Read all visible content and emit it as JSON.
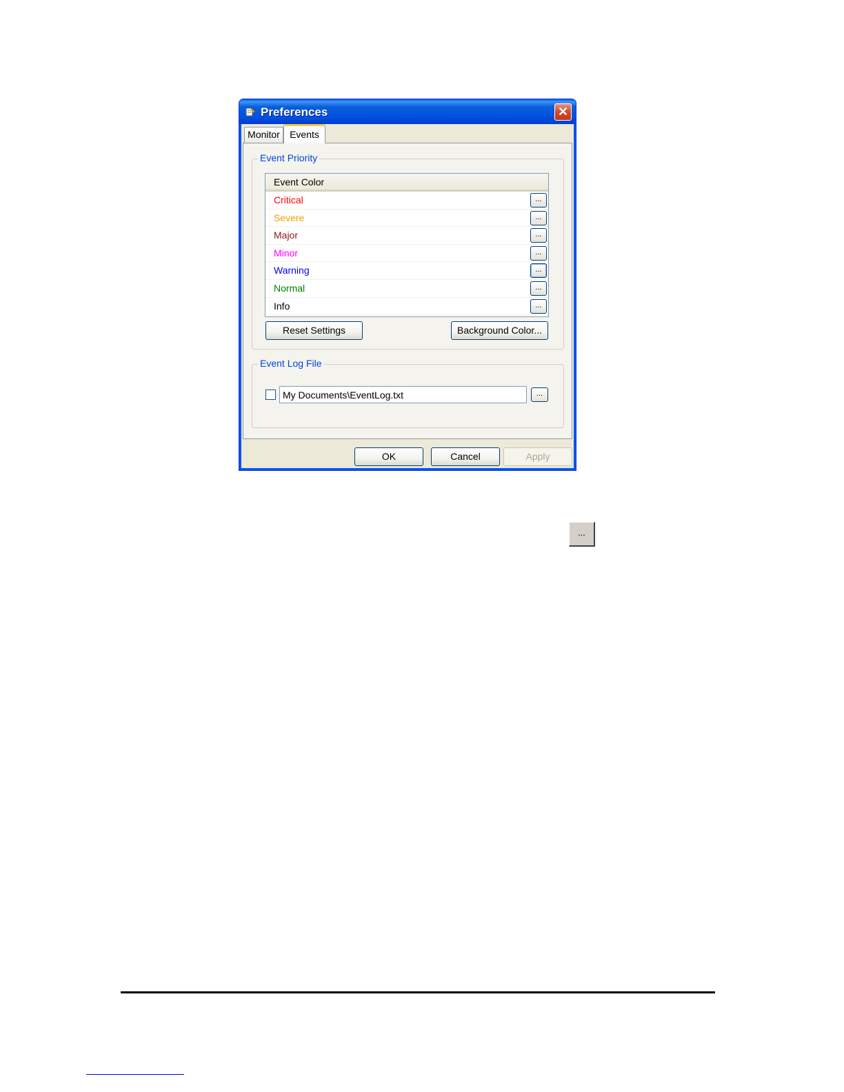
{
  "window": {
    "title": "Preferences",
    "close_label": "✕"
  },
  "tabs": [
    {
      "label": "Monitor",
      "selected": false
    },
    {
      "label": "Events",
      "selected": true
    }
  ],
  "event_priority": {
    "group_label": "Event Priority",
    "column_header": "Event Color",
    "rows": [
      {
        "label": "Critical",
        "color": "#ff0000",
        "button_label": "..."
      },
      {
        "label": "Severe",
        "color": "#f0a000",
        "button_label": "..."
      },
      {
        "label": "Major",
        "color": "#8b1a1a",
        "button_label": "..."
      },
      {
        "label": "Minor",
        "color": "#ff00ff",
        "button_label": "..."
      },
      {
        "label": "Warning",
        "color": "#0000ff",
        "button_label": "..."
      },
      {
        "label": "Normal",
        "color": "#008000",
        "button_label": "..."
      },
      {
        "label": "Info",
        "color": "#000000",
        "button_label": "..."
      }
    ],
    "reset_label": "Reset Settings",
    "background_label": "Background Color..."
  },
  "event_log": {
    "group_label": "Event Log File",
    "checked": false,
    "path_value": "My Documents\\EventLog.txt",
    "browse_label": "..."
  },
  "footer": {
    "ok_label": "OK",
    "cancel_label": "Cancel",
    "apply_label": "Apply"
  },
  "standalone_button_label": "..."
}
